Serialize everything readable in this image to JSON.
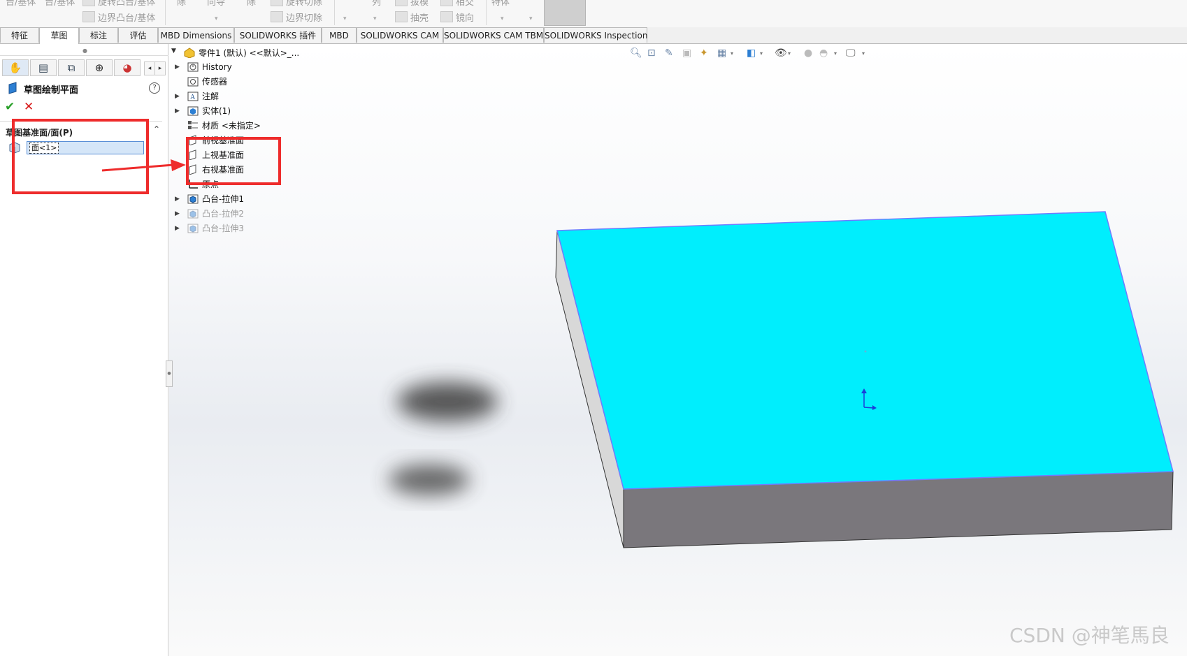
{
  "ribbon": {
    "items": [
      {
        "label": "台/基体",
        "icon": false
      },
      {
        "label": "台/基体",
        "icon": false
      },
      {
        "label": "旋转凸台/基体",
        "icon": true
      },
      {
        "label": "边界凸台/基体",
        "icon": true
      },
      {
        "label": "除",
        "icon": false
      },
      {
        "label": "向导",
        "icon": false
      },
      {
        "label": "除",
        "icon": false
      },
      {
        "label": "旋转切除",
        "icon": true
      },
      {
        "label": "边界切除",
        "icon": true
      },
      {
        "label": "列",
        "icon": false
      },
      {
        "label": "拔模",
        "icon": true
      },
      {
        "label": "抽壳",
        "icon": true
      },
      {
        "label": "相交",
        "icon": true
      },
      {
        "label": "镜向",
        "icon": true
      },
      {
        "label": "特体",
        "icon": false
      }
    ]
  },
  "tabs": [
    {
      "label": "特征"
    },
    {
      "label": "草图"
    },
    {
      "label": "标注"
    },
    {
      "label": "评估"
    },
    {
      "label": "MBD Dimensions"
    },
    {
      "label": "SOLIDWORKS 插件"
    },
    {
      "label": "MBD"
    },
    {
      "label": "SOLIDWORKS CAM"
    },
    {
      "label": "SOLIDWORKS CAM TBM"
    },
    {
      "label": "SOLIDWORKS Inspection"
    }
  ],
  "property_manager": {
    "title": "草图绘制平面",
    "help": "?",
    "ok": "✔",
    "cancel": "✕",
    "section_title": "草图基准面/面(P)",
    "selection_value": "面<1>"
  },
  "feature_tree": {
    "root": "零件1 (默认) <<默认>_...",
    "items": [
      {
        "label": "History",
        "icon": "history-icon",
        "caret": true,
        "dim": false
      },
      {
        "label": "传感器",
        "icon": "sensor-icon",
        "caret": false,
        "dim": false
      },
      {
        "label": "注解",
        "icon": "annotation-icon",
        "caret": true,
        "dim": false
      },
      {
        "label": "实体(1)",
        "icon": "solid-body-icon",
        "caret": true,
        "dim": false
      },
      {
        "label": "材质 <未指定>",
        "icon": "material-icon",
        "caret": false,
        "dim": false
      },
      {
        "label": "前视基准面",
        "icon": "plane-icon",
        "caret": false,
        "dim": false
      },
      {
        "label": "上视基准面",
        "icon": "plane-icon",
        "caret": false,
        "dim": false
      },
      {
        "label": "右视基准面",
        "icon": "plane-icon",
        "caret": false,
        "dim": false
      },
      {
        "label": "原点",
        "icon": "origin-icon",
        "caret": false,
        "dim": false
      },
      {
        "label": "凸台-拉伸1",
        "icon": "extrude-icon",
        "caret": true,
        "dim": false
      },
      {
        "label": "凸台-拉伸2",
        "icon": "extrude-icon",
        "caret": true,
        "dim": true
      },
      {
        "label": "凸台-拉伸3",
        "icon": "extrude-icon",
        "caret": true,
        "dim": true
      }
    ]
  },
  "colors": {
    "top_face": "#00eefd",
    "front_face": "#7a777c",
    "side_face": "#d8d8d8",
    "edge": "#6f7cff",
    "highlight": "#ee2c2c"
  },
  "watermark": "CSDN @神笔馬良"
}
